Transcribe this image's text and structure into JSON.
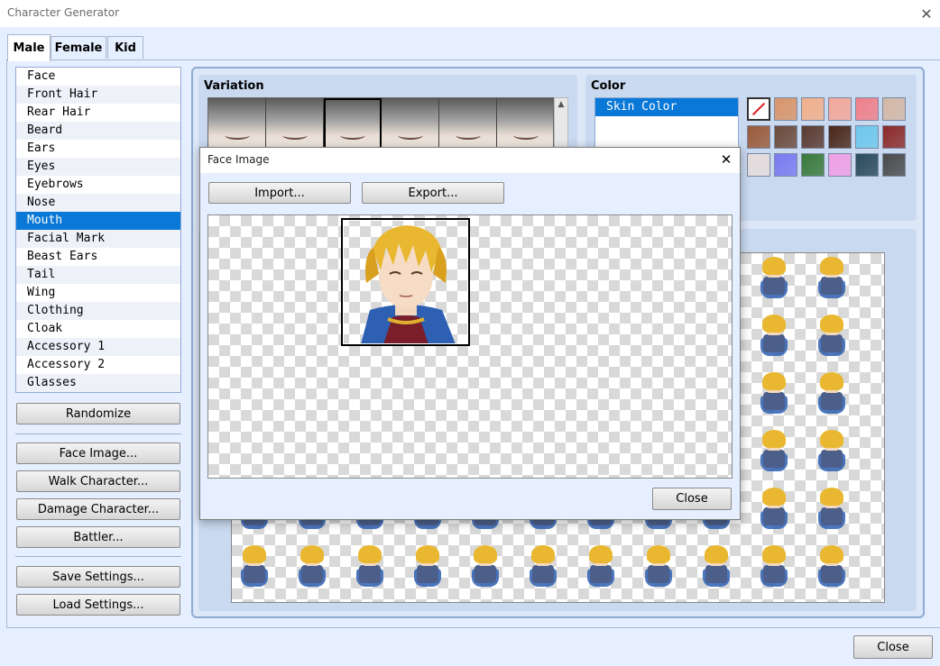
{
  "window": {
    "title": "Character Generator",
    "close_glyph": "✕"
  },
  "tabs": [
    "Male",
    "Female",
    "Kid"
  ],
  "parts": [
    "Face",
    "Front Hair",
    "Rear Hair",
    "Beard",
    "Ears",
    "Eyes",
    "Eyebrows",
    "Nose",
    "Mouth",
    "Facial Mark",
    "Beast Ears",
    "Tail",
    "Wing",
    "Clothing",
    "Cloak",
    "Accessory 1",
    "Accessory 2",
    "Glasses"
  ],
  "selected_part": "Mouth",
  "buttons": {
    "randomize": "Randomize",
    "face_image": "Face Image...",
    "walk_character": "Walk Character...",
    "damage_character": "Damage Character...",
    "battler": "Battler...",
    "save_settings": "Save Settings...",
    "load_settings": "Load Settings...",
    "close": "Close"
  },
  "variation": {
    "title": "Variation",
    "selected_index": 2,
    "count": 6
  },
  "color": {
    "title": "Color",
    "items": [
      "Skin Color"
    ],
    "swatches": [
      "none",
      "#d9956a",
      "#f2b08a",
      "#f4a89a",
      "#f0808a",
      "#d4b8a6",
      "#9a5a3a",
      "#6b4a3a",
      "#5a3a30",
      "#4a2818",
      "#6ec8ec",
      "#8c2a2a",
      "#e6dcdc",
      "#7a7af0",
      "#3a7a3a",
      "#f0a0e6",
      "#2a4a5a",
      "#4a4a4a"
    ]
  },
  "face_modal": {
    "title": "Face Image",
    "import": "Import...",
    "export": "Export...",
    "close": "Close",
    "close_glyph": "✕"
  },
  "colors": {
    "accent": "#0a78d7",
    "panel": "#e6efff",
    "hair": "#e9b830",
    "armor": "#2d5fb3"
  }
}
